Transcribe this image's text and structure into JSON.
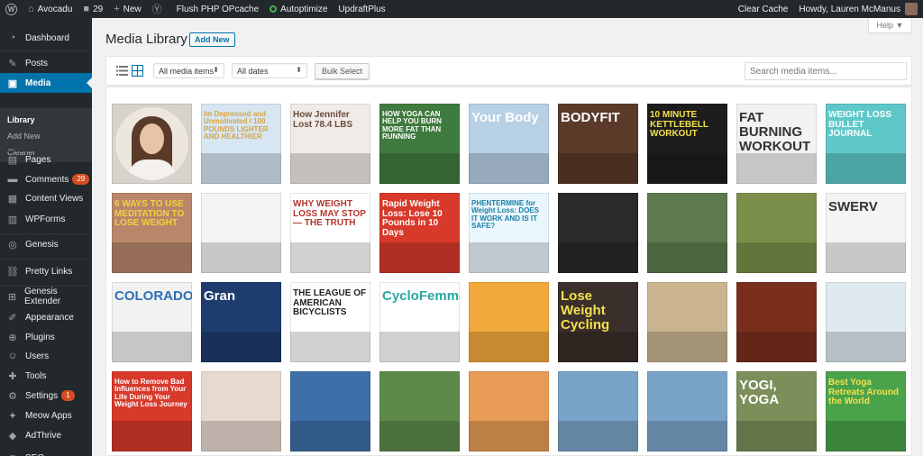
{
  "admin_bar": {
    "site_name": "Avocadu",
    "comments_count": "29",
    "new_label": "New",
    "items": [
      "Flush PHP OPcache",
      "Autoptimize",
      "UpdraftPlus"
    ],
    "clear_cache": "Clear Cache",
    "howdy": "Howdy, Lauren McManus"
  },
  "sidebar": {
    "items": [
      {
        "label": "Dashboard",
        "icon": "dashboard-icon"
      },
      {
        "label": "Posts",
        "icon": "pin-icon"
      },
      {
        "label": "Media",
        "icon": "media-icon"
      },
      {
        "label": "Pages",
        "icon": "pages-icon"
      },
      {
        "label": "Comments",
        "icon": "comments-icon",
        "badge": "29"
      },
      {
        "label": "Content Views",
        "icon": "content-views-icon"
      },
      {
        "label": "WPForms",
        "icon": "forms-icon"
      },
      {
        "label": "Genesis",
        "icon": "genesis-icon"
      },
      {
        "label": "Pretty Links",
        "icon": "links-icon"
      },
      {
        "label": "Genesis Extender",
        "icon": "extender-icon"
      },
      {
        "label": "Appearance",
        "icon": "brush-icon"
      },
      {
        "label": "Plugins",
        "icon": "plugin-icon"
      },
      {
        "label": "Users",
        "icon": "users-icon"
      },
      {
        "label": "Tools",
        "icon": "wrench-icon"
      },
      {
        "label": "Settings",
        "icon": "settings-icon",
        "badge": "1"
      },
      {
        "label": "Meow Apps",
        "icon": "meow-icon"
      },
      {
        "label": "AdThrive",
        "icon": "adthrive-icon"
      },
      {
        "label": "SEO",
        "icon": "seo-icon"
      }
    ],
    "submenu": [
      "Library",
      "Add New",
      "Cleaner"
    ]
  },
  "header": {
    "title": "Media Library",
    "add_new": "Add New",
    "help": "Help ▼"
  },
  "toolbar": {
    "filter_type": "All media items",
    "filter_date": "All dates",
    "bulk_select": "Bulk Select",
    "search_placeholder": "Search media items..."
  },
  "thumbnails": [
    {
      "bg": "#d8d2cc",
      "type": "portrait"
    },
    {
      "bg": "#d6e6f2",
      "text": "Im Depressed and Unmotivated / 100 POUNDS LIGHTER AND HEALTHIER",
      "color": "#d9a441"
    },
    {
      "bg": "#f0ebe7",
      "text": "How Jennifer Lost 78.4 LBS",
      "color": "#6a4c3b"
    },
    {
      "bg": "#3f7a3e",
      "text": "HOW YOGA CAN HELP YOU BURN MORE FAT THAN RUNNING",
      "color": "#ffffff"
    },
    {
      "bg": "#b8d0e6",
      "text": "Your Body",
      "color": "#ffffff"
    },
    {
      "bg": "#5b3a29",
      "text": "BODYFIT",
      "color": "#ffffff"
    },
    {
      "bg": "#1d1d1d",
      "text": "10 MINUTE KETTLEBELL WORKOUT",
      "color": "#f4e04d"
    },
    {
      "bg": "#f2f2f2",
      "text": "FAT BURNING WORKOUT",
      "color": "#333333"
    },
    {
      "bg": "#5ec8c8",
      "text": "WEIGHT LOSS BULLET JOURNAL",
      "color": "#ffffff"
    },
    {
      "bg": "#b8866b",
      "text": "6 WAYS TO USE MEDITATION TO LOSE WEIGHT",
      "color": "#f4d03f"
    },
    {
      "bg": "#f4f4f4",
      "text": "",
      "color": "#d94d6b"
    },
    {
      "bg": "#ffffff",
      "text": "WHY WEIGHT LOSS MAY STOP — THE TRUTH",
      "color": "#b3362d"
    },
    {
      "bg": "#d8392b",
      "text": "Rapid Weight Loss: Lose 10 Pounds in 10 Days",
      "color": "#ffffff"
    },
    {
      "bg": "#e9f6fb",
      "text": "PHENTERMINE for Weight Loss: DOES IT WORK AND IS IT SAFE?",
      "color": "#1a7fa8"
    },
    {
      "bg": "#2a2a2a",
      "text": "",
      "color": "#ffffff"
    },
    {
      "bg": "#5d7a4e",
      "text": "",
      "color": "#ffffff"
    },
    {
      "bg": "#7b8f4a",
      "text": "",
      "color": "#ffffff"
    },
    {
      "bg": "#f4f4f4",
      "text": "SWERV",
      "color": "#333333"
    },
    {
      "bg": "#f2f2f2",
      "text": "COLORADO",
      "color": "#2d6fb5"
    },
    {
      "bg": "#1f3c6e",
      "text": "Gran",
      "color": "#ffffff"
    },
    {
      "bg": "#ffffff",
      "text": "THE LEAGUE OF AMERICAN BICYCLISTS",
      "color": "#222222"
    },
    {
      "bg": "#ffffff",
      "text": "CycloFemme",
      "color": "#2aa7a0"
    },
    {
      "bg": "#f2a93b",
      "text": "",
      "color": "#111111"
    },
    {
      "bg": "#3a2f2a",
      "text": "Lose Weight Cycling",
      "color": "#f4e04d"
    },
    {
      "bg": "#c9b48f",
      "text": "",
      "color": "#ffffff"
    },
    {
      "bg": "#7a2f1d",
      "text": "",
      "color": "#ffffff"
    },
    {
      "bg": "#dfeaf0",
      "text": "",
      "color": "#ffffff"
    },
    {
      "bg": "#d8392b",
      "text": "How to Remove Bad Influences from Your Life During Your Weight Loss Journey",
      "color": "#ffffff"
    },
    {
      "bg": "#e8d9d0",
      "text": "",
      "color": "#ffffff"
    },
    {
      "bg": "#3f6fa8",
      "text": "",
      "color": "#ffffff"
    },
    {
      "bg": "#5d8a4b",
      "text": "",
      "color": "#ffffff"
    },
    {
      "bg": "#e79b55",
      "text": "",
      "color": "#ffffff"
    },
    {
      "bg": "#7aa3c9",
      "text": "",
      "color": "#ffffff"
    },
    {
      "bg": "#7aa3c9",
      "text": "",
      "color": "#ffffff"
    },
    {
      "bg": "#7c8f5a",
      "text": "YOGI, YOGA",
      "color": "#ffffff"
    },
    {
      "bg": "#4aa34a",
      "text": "Best Yoga Retreats Around the World",
      "color": "#f4e04d"
    }
  ]
}
